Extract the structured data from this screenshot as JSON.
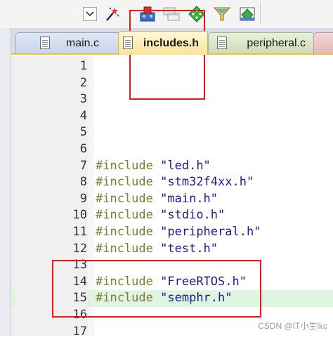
{
  "toolbar": {
    "buttons": [
      {
        "icon": "dropdown-arrow-icon"
      },
      {
        "icon": "magic-wand-icon"
      },
      {
        "icon": "build-target-icon"
      },
      {
        "icon": "window-layout-icon"
      },
      {
        "icon": "green-diamond-icon"
      },
      {
        "icon": "funnel-icon"
      },
      {
        "icon": "manage-components-icon"
      }
    ]
  },
  "tabs": [
    {
      "label": "main.c",
      "active": false,
      "color": "#c9d5ea"
    },
    {
      "label": "includes.h",
      "active": true,
      "color": "#fbe49a"
    },
    {
      "label": "peripheral.c",
      "active": false,
      "color": "#cfdcb5"
    },
    {
      "label": "",
      "active": false,
      "color": "#e4b7b7"
    }
  ],
  "editor": {
    "keyword_color": "#7b7b3a",
    "string_color": "#1d1d8c",
    "highlight_color": "#dff5df",
    "lines": [
      {
        "number": "1",
        "keyword": "",
        "value": ""
      },
      {
        "number": "2",
        "keyword": "",
        "value": ""
      },
      {
        "number": "3",
        "keyword": "",
        "value": ""
      },
      {
        "number": "4",
        "keyword": "",
        "value": ""
      },
      {
        "number": "5",
        "keyword": "",
        "value": ""
      },
      {
        "number": "6",
        "keyword": "",
        "value": ""
      },
      {
        "number": "7",
        "keyword": "#include",
        "value": "\"led.h\""
      },
      {
        "number": "8",
        "keyword": "#include",
        "value": "\"stm32f4xx.h\""
      },
      {
        "number": "9",
        "keyword": "#include",
        "value": "\"main.h\""
      },
      {
        "number": "10",
        "keyword": "#include",
        "value": "\"stdio.h\""
      },
      {
        "number": "11",
        "keyword": "#include",
        "value": "\"peripheral.h\""
      },
      {
        "number": "12",
        "keyword": "#include",
        "value": "\"test.h\""
      },
      {
        "number": "13",
        "keyword": "",
        "value": ""
      },
      {
        "number": "14",
        "keyword": "#include",
        "value": "\"FreeRTOS.h\""
      },
      {
        "number": "15",
        "keyword": "#include",
        "value": "\"semphr.h\"",
        "highlighted": true
      },
      {
        "number": "16",
        "keyword": "",
        "value": ""
      },
      {
        "number": "17",
        "keyword": "",
        "value": ""
      }
    ]
  },
  "annotation_color": "#dd1c1c",
  "watermark": "CSDN @IT小生lkc"
}
